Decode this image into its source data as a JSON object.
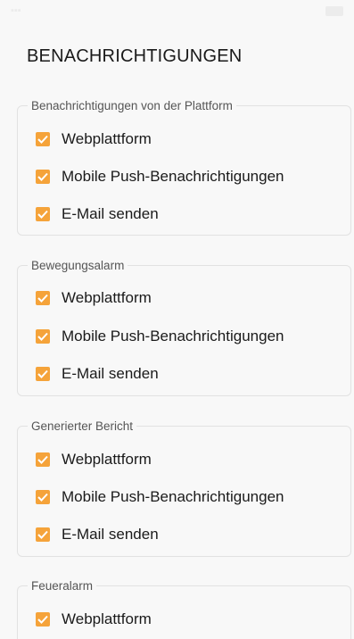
{
  "page": {
    "title": "BENACHRICHTIGUNGEN"
  },
  "colors": {
    "accent": "#f5a33a",
    "background": "#f8f8f8",
    "border": "#e2e2e2"
  },
  "groups": [
    {
      "legend": "Benachrichtigungen von der Plattform",
      "options": [
        {
          "label": "Webplattform",
          "checked": true
        },
        {
          "label": "Mobile Push-Benachrichtigungen",
          "checked": true
        },
        {
          "label": "E-Mail senden",
          "checked": true
        }
      ]
    },
    {
      "legend": "Bewegungsalarm",
      "options": [
        {
          "label": "Webplattform",
          "checked": true
        },
        {
          "label": "Mobile Push-Benachrichtigungen",
          "checked": true
        },
        {
          "label": "E-Mail senden",
          "checked": true
        }
      ]
    },
    {
      "legend": "Generierter Bericht",
      "options": [
        {
          "label": "Webplattform",
          "checked": true
        },
        {
          "label": "Mobile Push-Benachrichtigungen",
          "checked": true
        },
        {
          "label": "E-Mail senden",
          "checked": true
        }
      ]
    },
    {
      "legend": "Feueralarm",
      "options": [
        {
          "label": "Webplattform",
          "checked": true
        }
      ]
    }
  ]
}
